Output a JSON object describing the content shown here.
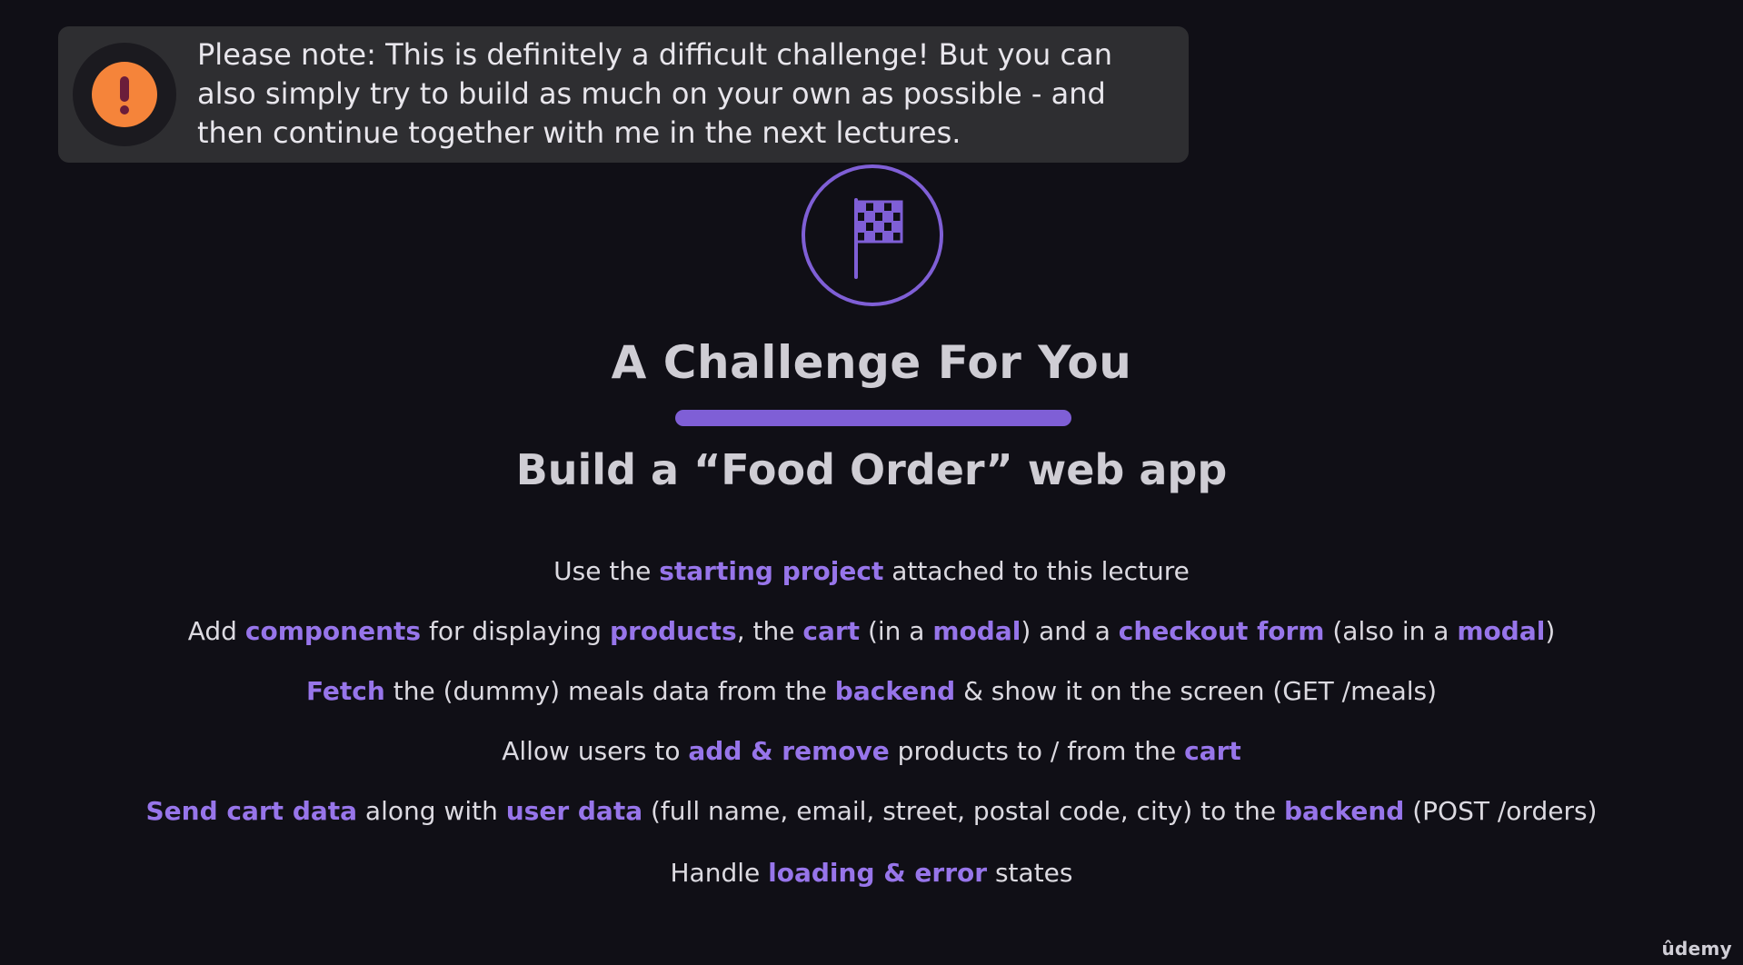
{
  "notice": {
    "icon": "exclamation-icon",
    "line1": "Please note: This is definitely a difficult challenge! But you can",
    "line2": "also simply try to build as much on your own as possible - and",
    "line3": "then continue together with me in the next lectures."
  },
  "emblem": {
    "icon": "checkered-flag-icon"
  },
  "title": "A Challenge For You",
  "subtitle": "Build a “Food Order” web app",
  "tasks": [
    [
      "Use the ",
      "starting project",
      " attached to this lecture"
    ],
    [
      "Add ",
      "components",
      " for displaying ",
      "products",
      ", the ",
      "cart",
      " (in a ",
      "modal",
      ") and a ",
      "checkout form",
      " (also in a ",
      "modal",
      ")"
    ],
    [
      "",
      "Fetch",
      " the (dummy) meals data from the ",
      "backend",
      " & show it on the screen (GET /meals)"
    ],
    [
      "Allow users to ",
      "add & remove",
      " products to / from the ",
      "cart",
      ""
    ],
    [
      "",
      "Send cart data",
      " along with ",
      "user data",
      " (full name, email, street, postal code, city) to the ",
      "backend",
      " (POST /orders)"
    ],
    [
      "Handle ",
      "loading & error",
      " states"
    ]
  ],
  "brand": "ûdemy",
  "colors": {
    "background": "#100f16",
    "highlight": "#9775ea",
    "accent_orange": "#f5843a",
    "notice_bg": "#2e2e31"
  }
}
